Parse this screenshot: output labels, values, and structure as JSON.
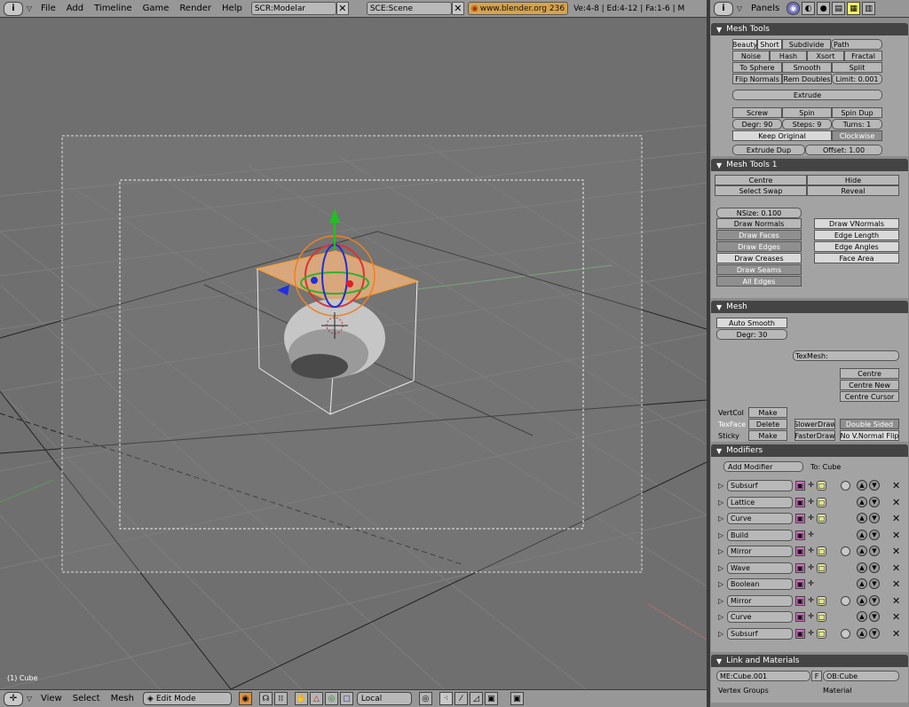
{
  "header": {
    "menus": [
      "File",
      "Add",
      "Timeline",
      "Game",
      "Render",
      "Help"
    ],
    "screen": "SCR:Modelar",
    "scene": "SCE:Scene",
    "url": "www.blender.org 236",
    "stats": "Ve:4-8 | Ed:4-12 | Fa:1-6 | M"
  },
  "viewport": {
    "object_label": "(1) Cube"
  },
  "footer": {
    "menus": [
      "View",
      "Select",
      "Mesh"
    ],
    "mode": "Edit Mode",
    "orientation": "Local"
  },
  "panels_header": {
    "title": "Panels"
  },
  "mesh_tools": {
    "title": "Mesh Tools",
    "beauty": "Beauty",
    "short": "Short",
    "subdivide": "Subdivide",
    "path": "Path",
    "noise": "Noise",
    "hash": "Hash",
    "xsort": "Xsort",
    "fractal": "Fractal",
    "to_sphere": "To Sphere",
    "smooth": "Smooth",
    "split": "Split",
    "flip_normals": "Flip Normals",
    "rem_doubles": "Rem Doubles",
    "limit": "Limit: 0.001",
    "extrude": "Extrude",
    "screw": "Screw",
    "spin": "Spin",
    "spin_dup": "Spin Dup",
    "degr": "Degr: 90",
    "steps": "Steps: 9",
    "turns": "Turns: 1",
    "keep_original": "Keep Original",
    "clockwise": "Clockwise",
    "extrude_dup": "Extrude Dup",
    "offset": "Offset: 1.00"
  },
  "mesh_tools_1": {
    "title": "Mesh Tools 1",
    "centre": "Centre",
    "hide": "Hide",
    "select_swap": "Select Swap",
    "reveal": "Reveal",
    "nsize": "NSize: 0.100",
    "draw_normals": "Draw Normals",
    "draw_faces": "Draw Faces",
    "draw_edges": "Draw Edges",
    "draw_creases": "Draw Creases",
    "draw_seams": "Draw Seams",
    "all_edges": "All Edges",
    "draw_vnormals": "Draw VNormals",
    "edge_length": "Edge Length",
    "edge_angles": "Edge Angles",
    "face_area": "Face Area"
  },
  "mesh": {
    "title": "Mesh",
    "auto_smooth": "Auto Smooth",
    "degr": "Degr: 30",
    "texmesh": "TexMesh:",
    "centre": "Centre",
    "centre_new": "Centre New",
    "centre_cursor": "Centre Cursor",
    "vertcol": "VertCol",
    "texface": "TexFace",
    "sticky": "Sticky",
    "make": "Make",
    "delete": "Delete",
    "slower_draw": "SlowerDraw",
    "faster_draw": "FasterDraw",
    "double_sided": "Double Sided",
    "no_vnormal_flip": "No V.Normal Flip"
  },
  "modifiers": {
    "title": "Modifiers",
    "add_modifier": "Add Modifier",
    "to": "To: Cube",
    "items": [
      {
        "name": "Subsurf"
      },
      {
        "name": "Lattice"
      },
      {
        "name": "Curve"
      },
      {
        "name": "Build"
      },
      {
        "name": "Mirror"
      },
      {
        "name": "Wave"
      },
      {
        "name": "Boolean"
      },
      {
        "name": "Mirror"
      },
      {
        "name": "Curve"
      },
      {
        "name": "Subsurf"
      }
    ]
  },
  "link_materials": {
    "title": "Link and Materials",
    "me": "ME:Cube.001",
    "f": "F",
    "ob": "OB:Cube",
    "vertex_groups": "Vertex Groups",
    "material": "Material"
  }
}
